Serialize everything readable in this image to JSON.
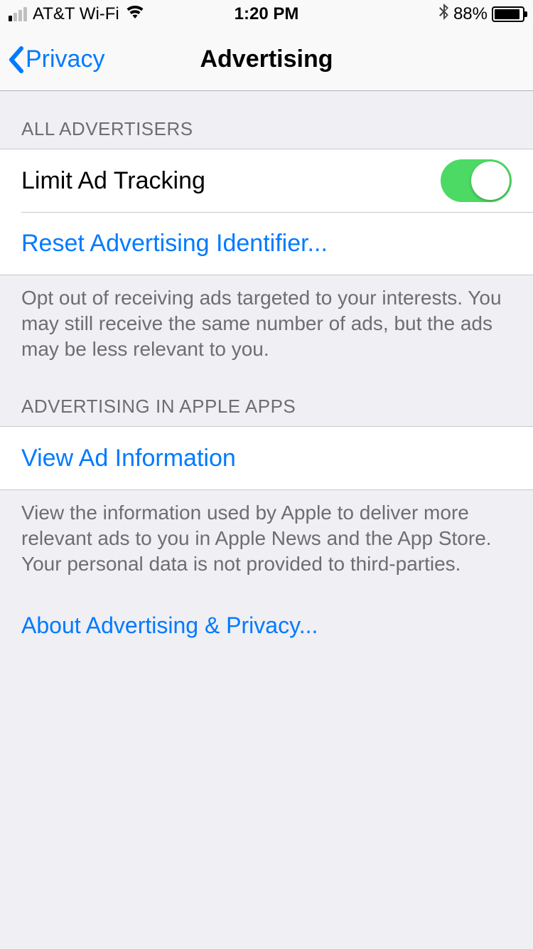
{
  "status_bar": {
    "carrier": "AT&T Wi-Fi",
    "time": "1:20 PM",
    "battery_pct": "88%"
  },
  "nav": {
    "back_label": "Privacy",
    "title": "Advertising"
  },
  "sections": {
    "all_advertisers": {
      "header": "ALL ADVERTISERS",
      "limit_tracking_label": "Limit Ad Tracking",
      "limit_tracking_enabled": true,
      "reset_label": "Reset Advertising Identifier...",
      "footer": "Opt out of receiving ads targeted to your interests. You may still receive the same number of ads, but the ads may be less relevant to you."
    },
    "apple_apps": {
      "header": "ADVERTISING IN APPLE APPS",
      "view_info_label": "View Ad Information",
      "footer": "View the information used by Apple to deliver more relevant ads to you in Apple News and the App Store. Your personal data is not provided to third-parties."
    }
  },
  "about_link": "About Advertising & Privacy..."
}
